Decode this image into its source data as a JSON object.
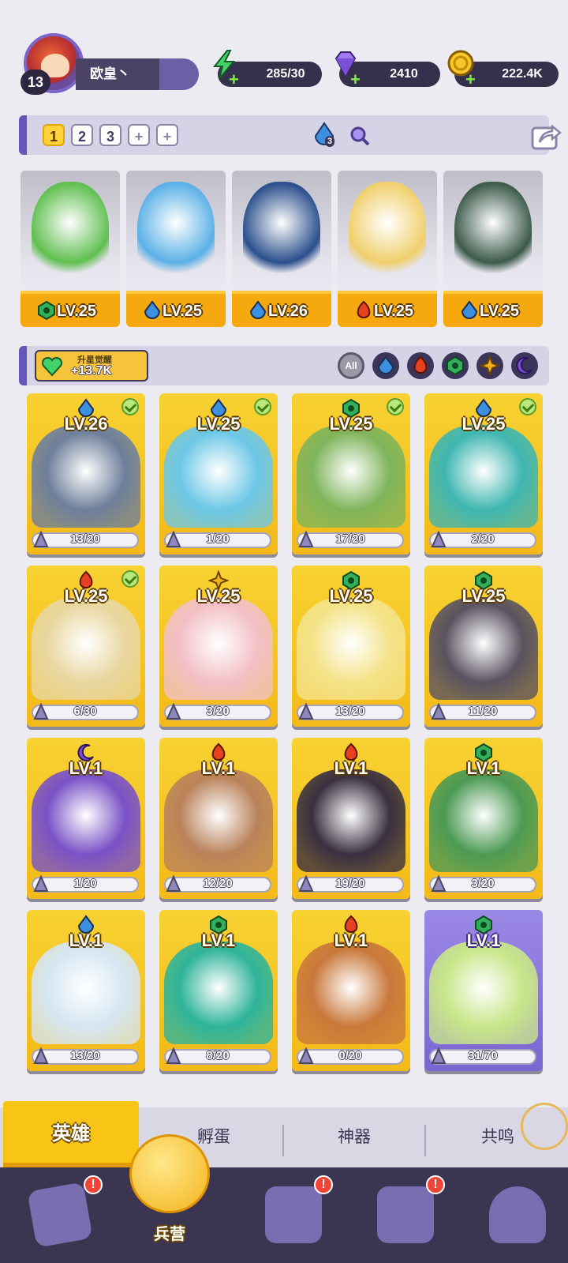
{
  "player": {
    "level": "13",
    "name": "欧皇丶"
  },
  "resources": {
    "energy": "285/30",
    "gems": "2410",
    "coins": "222.4K"
  },
  "team": {
    "slots": [
      "1",
      "2",
      "3",
      "+",
      "+"
    ],
    "element_count": "3",
    "heroes": [
      {
        "level": "LV.25",
        "element": "nature",
        "color": "#5fbf4f"
      },
      {
        "level": "LV.25",
        "element": "water",
        "color": "#5ab0e6"
      },
      {
        "level": "LV.26",
        "element": "water",
        "color": "#2a4f8c"
      },
      {
        "level": "LV.25",
        "element": "fire",
        "color": "#f0cf6b"
      },
      {
        "level": "LV.25",
        "element": "water",
        "color": "#3c5a4a"
      }
    ]
  },
  "awaken": {
    "label": "升星觉醒",
    "value": "+13.7K"
  },
  "filters": [
    "All",
    "water",
    "fire",
    "nature",
    "light",
    "dark"
  ],
  "colors": {
    "water": "#3d8fe0",
    "fire": "#e5401f",
    "nature": "#32b05a",
    "light": "#f0b21a",
    "dark": "#7d4ed8"
  },
  "heroes": [
    {
      "level": "LV.26",
      "element": "water",
      "shards": "13/20",
      "checked": true,
      "art": "#6e7f9b"
    },
    {
      "level": "LV.25",
      "element": "water",
      "shards": "1/20",
      "checked": true,
      "art": "#6cc7e6"
    },
    {
      "level": "LV.25",
      "element": "nature",
      "shards": "17/20",
      "checked": true,
      "art": "#7fb45a"
    },
    {
      "level": "LV.25",
      "element": "water",
      "shards": "2/20",
      "checked": true,
      "art": "#3fb6b0"
    },
    {
      "level": "LV.25",
      "element": "fire",
      "shards": "6/30",
      "checked": true,
      "art": "#e9d7a0"
    },
    {
      "level": "LV.25",
      "element": "light",
      "shards": "3/20",
      "checked": false,
      "art": "#f2c0c6"
    },
    {
      "level": "LV.25",
      "element": "nature",
      "shards": "13/20",
      "checked": false,
      "art": "#f4e389"
    },
    {
      "level": "LV.25",
      "element": "nature",
      "shards": "11/20",
      "checked": false,
      "art": "#5a5360"
    },
    {
      "level": "LV.1",
      "element": "dark",
      "shards": "1/20",
      "checked": false,
      "art": "#7a52c6"
    },
    {
      "level": "LV.1",
      "element": "fire",
      "shards": "12/20",
      "checked": false,
      "art": "#b9825a"
    },
    {
      "level": "LV.1",
      "element": "fire",
      "shards": "19/20",
      "checked": false,
      "art": "#3a3040"
    },
    {
      "level": "LV.1",
      "element": "nature",
      "shards": "3/20",
      "checked": false,
      "art": "#4c9a54"
    },
    {
      "level": "LV.1",
      "element": "water",
      "shards": "13/20",
      "checked": false,
      "art": "#d6e6f2"
    },
    {
      "level": "LV.1",
      "element": "nature",
      "shards": "8/20",
      "checked": false,
      "art": "#2fb49a"
    },
    {
      "level": "LV.1",
      "element": "fire",
      "shards": "0/20",
      "checked": false,
      "art": "#c9783a"
    },
    {
      "level": "LV.1",
      "element": "nature",
      "shards": "31/70",
      "checked": false,
      "art": "#c9e68a",
      "purple": true
    }
  ],
  "subtabs": {
    "active": "英雄",
    "items": [
      "孵蛋",
      "神器",
      "共鸣"
    ]
  },
  "nav": {
    "active_label": "兵营",
    "alert": "!"
  }
}
